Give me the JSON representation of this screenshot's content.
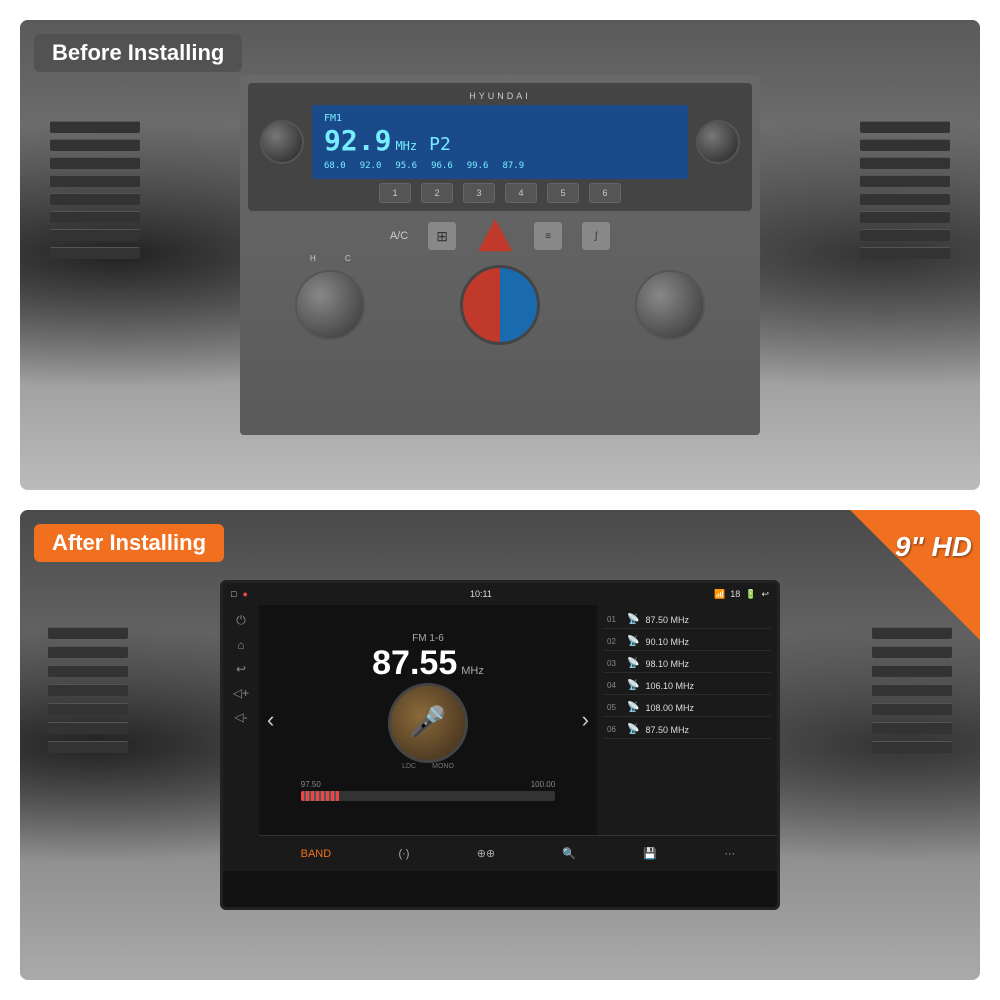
{
  "before": {
    "label": "Before Installing",
    "radio": {
      "brand": "HYUNDAI",
      "mode": "FM1",
      "frequency": "92.9",
      "unit": "MHz",
      "preset": "P2",
      "presets": [
        "68.0",
        "92.0",
        "95.6",
        "96.6",
        "99.6",
        "87.9"
      ],
      "buttons": [
        "1",
        "2",
        "3",
        "4",
        "5",
        "6"
      ]
    }
  },
  "after": {
    "label": "After Installing",
    "badge": "9\" HD",
    "headunit": {
      "statusbar": {
        "left": [
          "□",
          "⬛",
          "●"
        ],
        "time": "10:11",
        "right": [
          "📶",
          "18",
          "🔋",
          "↩"
        ]
      },
      "mode": "FM 1-6",
      "frequency": "87.55",
      "unit": "MHz",
      "album_icon": "🎤",
      "signal_left": "97.50",
      "signal_right": "100.00",
      "ldc": "LDC",
      "mono": "MONO",
      "presets": [
        {
          "num": "01",
          "freq": "87.50 MHz"
        },
        {
          "num": "02",
          "freq": "90.10 MHz"
        },
        {
          "num": "03",
          "freq": "98.10 MHz"
        },
        {
          "num": "04",
          "freq": "106.10 MHz"
        },
        {
          "num": "05",
          "freq": "108.00 MHz"
        },
        {
          "num": "06",
          "freq": "87.50 MHz"
        }
      ],
      "toolbar": [
        "BAND",
        "(·)",
        "⊕⊕",
        "🔍+",
        "💾",
        "···"
      ],
      "sidebar_icons": [
        "⏻",
        "⌂",
        "↩",
        "◁+",
        "◁-"
      ]
    }
  }
}
